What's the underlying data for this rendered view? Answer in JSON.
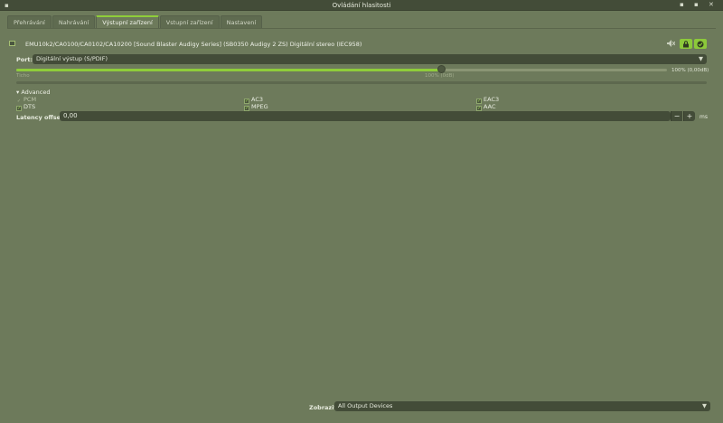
{
  "window": {
    "title": "Ovládání hlasitosti",
    "menu_glyph": "▪",
    "buttons": {
      "minimize": "▪",
      "maximize": "▪",
      "close": "✕"
    }
  },
  "tabs": [
    {
      "label": "Přehrávání",
      "active": false
    },
    {
      "label": "Nahrávání",
      "active": false
    },
    {
      "label": "Výstupní zařízení",
      "active": true
    },
    {
      "label": "Vstupní zařízení",
      "active": false
    },
    {
      "label": "Nastavení",
      "active": false
    }
  ],
  "device": {
    "name": "EMU10k2/CA0100/CA0102/CA10200 [Sound Blaster Audigy Series] (SB0350 Audigy 2 ZS) Digitální stereo (IEC958)",
    "icons": {
      "card": "sound-card-icon",
      "mute": "speaker-mute-icon",
      "lock": "lock-channels-icon",
      "default": "set-default-icon"
    }
  },
  "port": {
    "label": "Port:",
    "value": "Digitální výstup (S/PDIF)"
  },
  "volume": {
    "level_fraction": 1.0,
    "readout": "100% (0,00dB)",
    "tick_quiet": "Ticho",
    "tick_100": "100% (0dB)"
  },
  "advanced": {
    "label": "Advanced",
    "codecs": [
      {
        "label": "PCM",
        "checked": true,
        "enabled": false
      },
      {
        "label": "AC3",
        "checked": true,
        "enabled": true
      },
      {
        "label": "EAC3",
        "checked": true,
        "enabled": true
      },
      {
        "label": "DTS",
        "checked": true,
        "enabled": true
      },
      {
        "label": "MPEG",
        "checked": true,
        "enabled": true
      },
      {
        "label": "AAC",
        "checked": true,
        "enabled": true
      }
    ]
  },
  "latency": {
    "label": "Latency offset:",
    "value": "0,00",
    "unit": "ms",
    "minus": "−",
    "plus": "+"
  },
  "footer": {
    "show_label": "Zobrazit:",
    "show_value": "All Output Devices"
  },
  "colors": {
    "accent": "#8fcd3a",
    "background": "#6d7a5b",
    "input_bg": "#434c38"
  }
}
